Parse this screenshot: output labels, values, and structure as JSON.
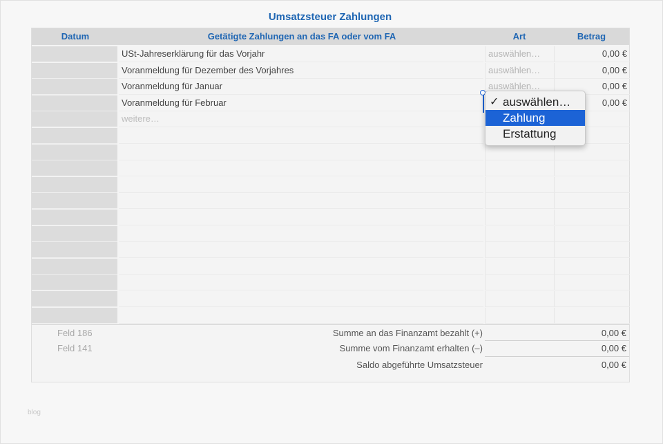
{
  "title": "Umsatzsteuer Zahlungen",
  "header": {
    "date": "Datum",
    "description": "Getätigte Zahlungen an das FA oder vom FA",
    "type": "Art",
    "amount": "Betrag"
  },
  "rows": [
    {
      "description": "USt-Jahreserklärung für das Vorjahr",
      "type": "auswählen…",
      "amount": "0,00 €"
    },
    {
      "description": "Voranmeldung für Dezember des Vorjahres",
      "type": "auswählen…",
      "amount": "0,00 €"
    },
    {
      "description": "Voranmeldung für Januar",
      "type": "auswählen…",
      "amount": "0,00 €"
    },
    {
      "description": "Voranmeldung für Februar",
      "type": "",
      "amount": "0,00 €"
    },
    {
      "description": "weitere…",
      "type": "",
      "amount": ""
    }
  ],
  "summary": [
    {
      "field": "Feld 186",
      "label": "Summe an das Finanzamt bezahlt (+)",
      "amount": "0,00 €"
    },
    {
      "field": "Feld 141",
      "label": "Summe vom Finanzamt erhalten (–)",
      "amount": "0,00 €"
    },
    {
      "field": "",
      "label": "Saldo abgeführte Umsatzsteuer",
      "amount": "0,00 €"
    }
  ],
  "dropdown": {
    "options": [
      {
        "label": "auswählen…",
        "checked": "✓"
      },
      {
        "label": "Zahlung",
        "checked": ""
      },
      {
        "label": "Erstattung",
        "checked": ""
      }
    ],
    "highlighted_index": 1
  },
  "footer_mark": "blog",
  "colors": {
    "accent": "#1f66b3",
    "selection": "#1c63d6",
    "header_bg": "#d9d9d9"
  },
  "icons": {
    "checkmark": "checkmark-icon"
  }
}
